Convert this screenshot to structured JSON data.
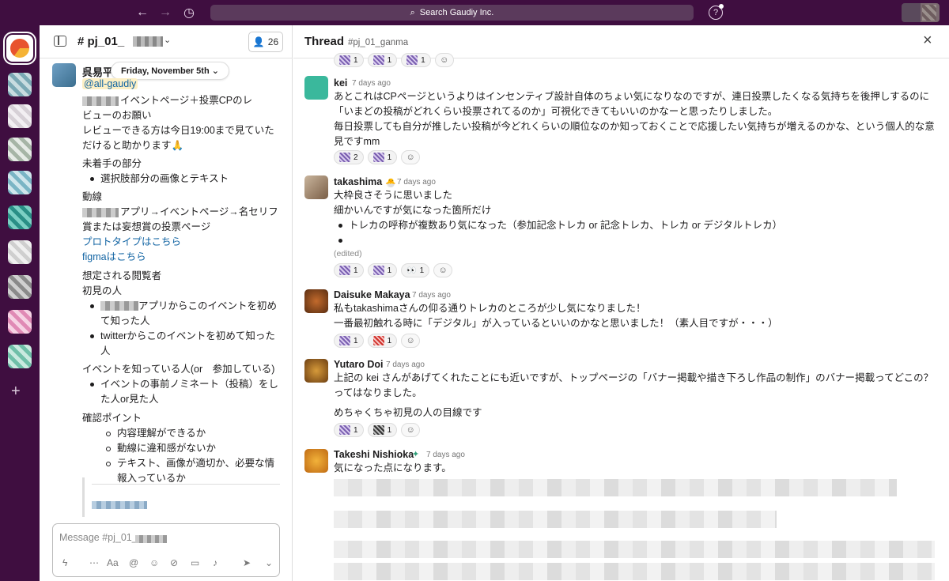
{
  "topbar": {
    "back_icon": "arrow-left-icon",
    "forward_icon": "arrow-right-icon",
    "history_icon": "clock-icon",
    "search_placeholder": "Search Gaudiy Inc.",
    "help_icon": "help-icon"
  },
  "left": {
    "channel_name": "# pj_01_",
    "member_count": "26",
    "author": "呉易平",
    "date_pill": "Friday, November 5th",
    "mention": "@all-gaudiy",
    "lines": [
      "イベントページ＋投票CPのレ",
      "ビューのお願い",
      "レビューできる方は今日19:00まで見ていた",
      "だけると助かります🙏",
      "未着手の部分",
      "選択肢部分の画像とテキスト",
      "動線",
      "アプリ→イベントページ→名セリフ",
      "賞または妄想賞の投票ページ",
      "プロトタイプはこちら",
      "figmaはこちら",
      "想定される閲覧者",
      "初見の人",
      "アプリからこのイベントを初め",
      "て知った人",
      "twitterからこのイベントを初めて知った",
      "人",
      "イベントを知っている人(or　参加している)",
      "イベントの事前ノミネート（投稿）をし",
      "た人or見た人",
      "確認ポイント",
      "内容理解ができるか",
      "動線に違和感がないか",
      "テキスト、画像が適切か、必要な情",
      "報入っているか"
    ],
    "composer_placeholder": "Message #pj_01_"
  },
  "thread": {
    "title": "Thread",
    "channel": "#pj_01_ganma",
    "top_reactions": [
      "1",
      "1",
      "1"
    ],
    "messages": [
      {
        "author": "kei",
        "time": "7 days ago",
        "lines": [
          "あとこれはCPページというよりはインセンティブ設計自体のちょい気になりなのですが、連日投票したくなる気持ちを後押しするのに",
          "「いまどの投稿がどれくらい投票されてるのか」可視化できてもいいのかなーと思ったりしました。",
          "毎日投票しても自分が推したい投稿が今どれくらいの順位なのか知っておくことで応援したい気持ちが増えるのかな、という個人的な意",
          "見ですmm"
        ],
        "reactions": [
          "2",
          "1"
        ]
      },
      {
        "author": "takashima",
        "time": "7 days ago",
        "lines": [
          "大枠良さそうに思いました",
          "細かいんですが気になった箇所だけ",
          "トレカの呼称が複数あり気になった（参加記念トレカ or 記念トレカ、トレカ or デジタルトレカ）"
        ],
        "edited": "(edited)",
        "reactions": [
          "1",
          "1",
          "1"
        ]
      },
      {
        "author": "Daisuke Makaya",
        "time": "7 days ago",
        "lines": [
          "私もtakashimaさんの仰る通りトレカのところが少し気になりました！",
          "一番最初触れる時に「デジタル」が入っているといいのかなと思いました！（素人目ですが・・・）"
        ],
        "reactions": [
          "1",
          "1"
        ]
      },
      {
        "author": "Yutaro Doi",
        "time": "7 days ago",
        "lines": [
          "上記の kei さんがあげてくれたことにも近いですが、トップページの「バナー掲載や描き下ろし作品の制作」のバナー掲載ってどこの？",
          "ってはなりました。",
          "めちゃくちゃ初見の人の目線です"
        ],
        "reactions": [
          "1",
          "1"
        ]
      },
      {
        "author": "Takeshi Nishioka",
        "time": "7 days ago",
        "lines": [
          "気になった点になります。"
        ]
      }
    ]
  }
}
